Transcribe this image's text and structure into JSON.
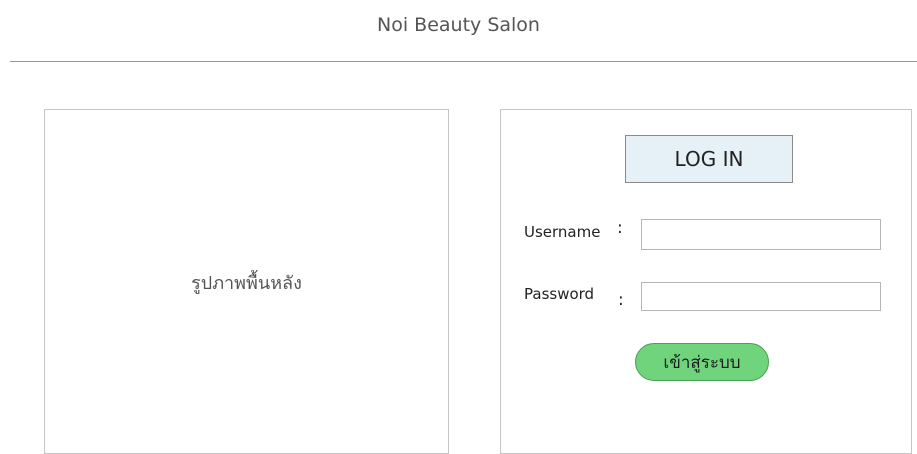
{
  "header": {
    "title": "Noi Beauty Salon"
  },
  "background_panel": {
    "label": "รูปภาพพื้นหลัง"
  },
  "login": {
    "heading": "LOG IN",
    "username_label": "Username",
    "password_label": "Password",
    "colon": ":",
    "username_value": "",
    "password_value": "",
    "submit_label": "เข้าสู่ระบบ"
  },
  "colors": {
    "heading_bg": "#e6f0f7",
    "submit_bg": "#6fd47c",
    "divider": "#9a9a9a"
  }
}
